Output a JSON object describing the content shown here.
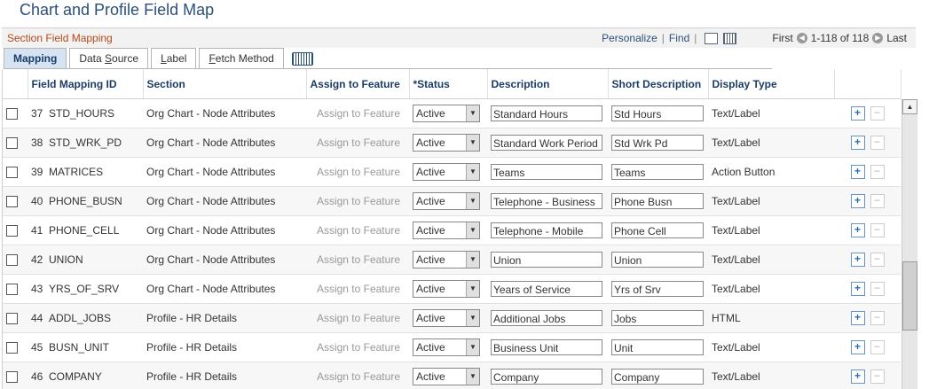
{
  "page": {
    "title": "Chart and Profile Field Map"
  },
  "grid": {
    "section_title": "Section Field Mapping",
    "personalize": "Personalize",
    "find": "Find",
    "first": "First",
    "range": "1-118 of 118",
    "last": "Last"
  },
  "tabs": [
    {
      "label": "Mapping"
    },
    {
      "label_pre": "Data ",
      "label_u": "S",
      "label_post": "ource"
    },
    {
      "label_pre": "",
      "label_u": "L",
      "label_post": "abel"
    },
    {
      "label_pre": "",
      "label_u": "F",
      "label_post": "etch Method"
    }
  ],
  "columns": {
    "id": "Field Mapping ID",
    "section": "Section",
    "assign": "Assign to Feature",
    "status": "*Status",
    "description": "Description",
    "short": "Short Description",
    "display": "Display Type"
  },
  "rows": [
    {
      "num": "37",
      "field": "STD_HOURS",
      "section": "Org Chart - Node Attributes",
      "assign": "Assign to Feature",
      "status": "Active",
      "description": "Standard Hours",
      "short": "Std Hours",
      "display": "Text/Label"
    },
    {
      "num": "38",
      "field": "STD_WRK_PD",
      "section": "Org Chart - Node Attributes",
      "assign": "Assign to Feature",
      "status": "Active",
      "description": "Standard Work Period",
      "short": "Std Wrk Pd",
      "display": "Text/Label"
    },
    {
      "num": "39",
      "field": "MATRICES",
      "section": "Org Chart - Node Attributes",
      "assign": "Assign to Feature",
      "status": "Active",
      "description": "Teams",
      "short": "Teams",
      "display": "Action Button"
    },
    {
      "num": "40",
      "field": "PHONE_BUSN",
      "section": "Org Chart - Node Attributes",
      "assign": "Assign to Feature",
      "status": "Active",
      "description": "Telephone - Business",
      "short": "Phone Busn",
      "display": "Text/Label"
    },
    {
      "num": "41",
      "field": "PHONE_CELL",
      "section": "Org Chart - Node Attributes",
      "assign": "Assign to Feature",
      "status": "Active",
      "description": "Telephone - Mobile",
      "short": "Phone Cell",
      "display": "Text/Label"
    },
    {
      "num": "42",
      "field": "UNION",
      "section": "Org Chart - Node Attributes",
      "assign": "Assign to Feature",
      "status": "Active",
      "description": "Union",
      "short": "Union",
      "display": "Text/Label"
    },
    {
      "num": "43",
      "field": "YRS_OF_SRV",
      "section": "Org Chart - Node Attributes",
      "assign": "Assign to Feature",
      "status": "Active",
      "description": "Years of Service",
      "short": "Yrs of Srv",
      "display": "Text/Label"
    },
    {
      "num": "44",
      "field": "ADDL_JOBS",
      "section": "Profile - HR Details",
      "assign": "Assign to Feature",
      "status": "Active",
      "description": "Additional Jobs",
      "short": "Jobs",
      "display": "HTML"
    },
    {
      "num": "45",
      "field": "BUSN_UNIT",
      "section": "Profile - HR Details",
      "assign": "Assign to Feature",
      "status": "Active",
      "description": "Business Unit",
      "short": "Unit",
      "display": "Text/Label"
    },
    {
      "num": "46",
      "field": "COMPANY",
      "section": "Profile - HR Details",
      "assign": "Assign to Feature",
      "status": "Active",
      "description": "Company",
      "short": "Company",
      "display": "Text/Label"
    }
  ]
}
